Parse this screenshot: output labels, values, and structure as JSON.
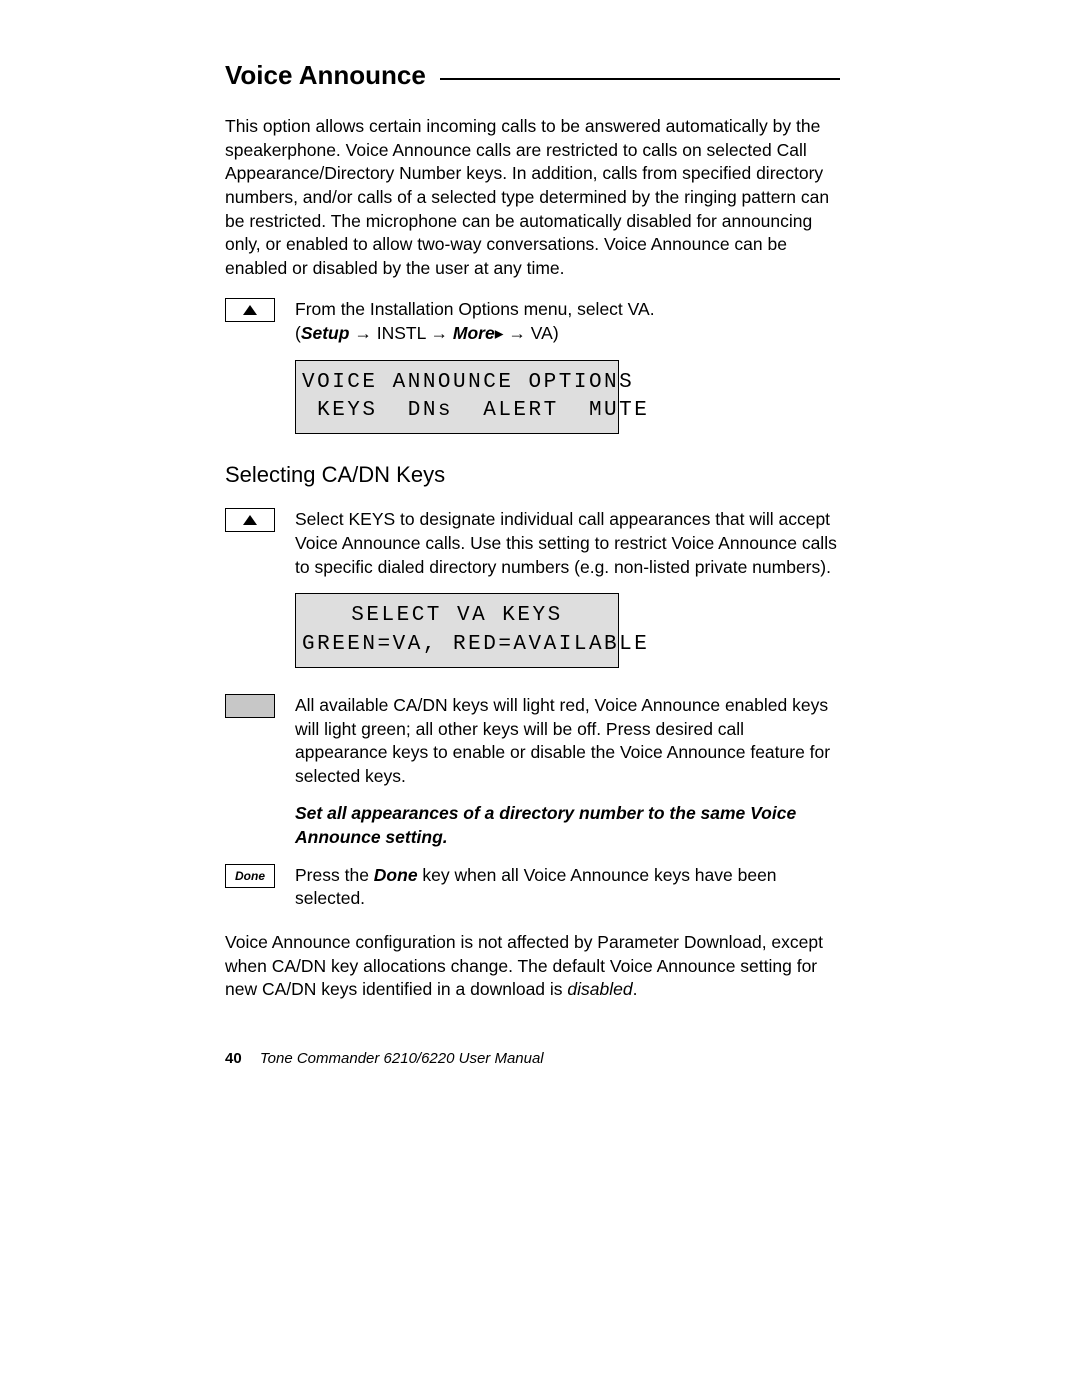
{
  "heading": "Voice Announce",
  "intro": "This option allows certain incoming calls to be answered automatically by the speakerphone. Voice Announce calls are restricted to calls on selected Call Appearance/Directory Number keys. In addition, calls from specified directory numbers, and/or calls of a selected type determined by the ringing pattern can be restricted. The microphone can be automatically disabled for announcing only, or enabled to allow two-way conversations. Voice Announce can be enabled or disabled by the user at any time.",
  "step1": {
    "text": "From the Installation Options menu, select VA.",
    "seq_setup": "Setup",
    "seq_instl": "INSTL",
    "seq_more": "More",
    "seq_va": "VA",
    "arrow": "→",
    "rtri": "▸"
  },
  "lcd1": {
    "line1": "VOICE ANNOUNCE OPTIONS",
    "line2": " KEYS  DNs  ALERT  MUTE"
  },
  "subheading": "Selecting CA/DN Keys",
  "step2": {
    "text": "Select KEYS to designate individual call appearances that will accept Voice Announce calls. Use this setting to restrict Voice Announce calls to specific dialed directory numbers (e.g. non-listed private numbers)."
  },
  "lcd2": {
    "line1": "SELECT VA KEYS",
    "line2": "GREEN=VA, RED=AVAILABLE"
  },
  "step3": {
    "text": "All available CA/DN keys will light red, Voice Announce enabled keys will light green; all other keys will be off. Press desired call appearance keys to enable or disable the Voice Announce feature for selected keys."
  },
  "note": "Set all appearances of a directory number to the same Voice Announce setting.",
  "done_label": "Done",
  "step4": {
    "pre": "Press the ",
    "done_word": "Done",
    "post": " key when all Voice Announce keys have been selected."
  },
  "end": {
    "main": "Voice Announce configuration is not affected by Parameter Download, except when CA/DN key allocations change. The default Voice Announce setting for new CA/DN keys identified in a download is ",
    "disabled_word": "disabled",
    "dot": "."
  },
  "footer": {
    "page": "40",
    "book": "Tone Commander 6210/6220 User Manual"
  }
}
